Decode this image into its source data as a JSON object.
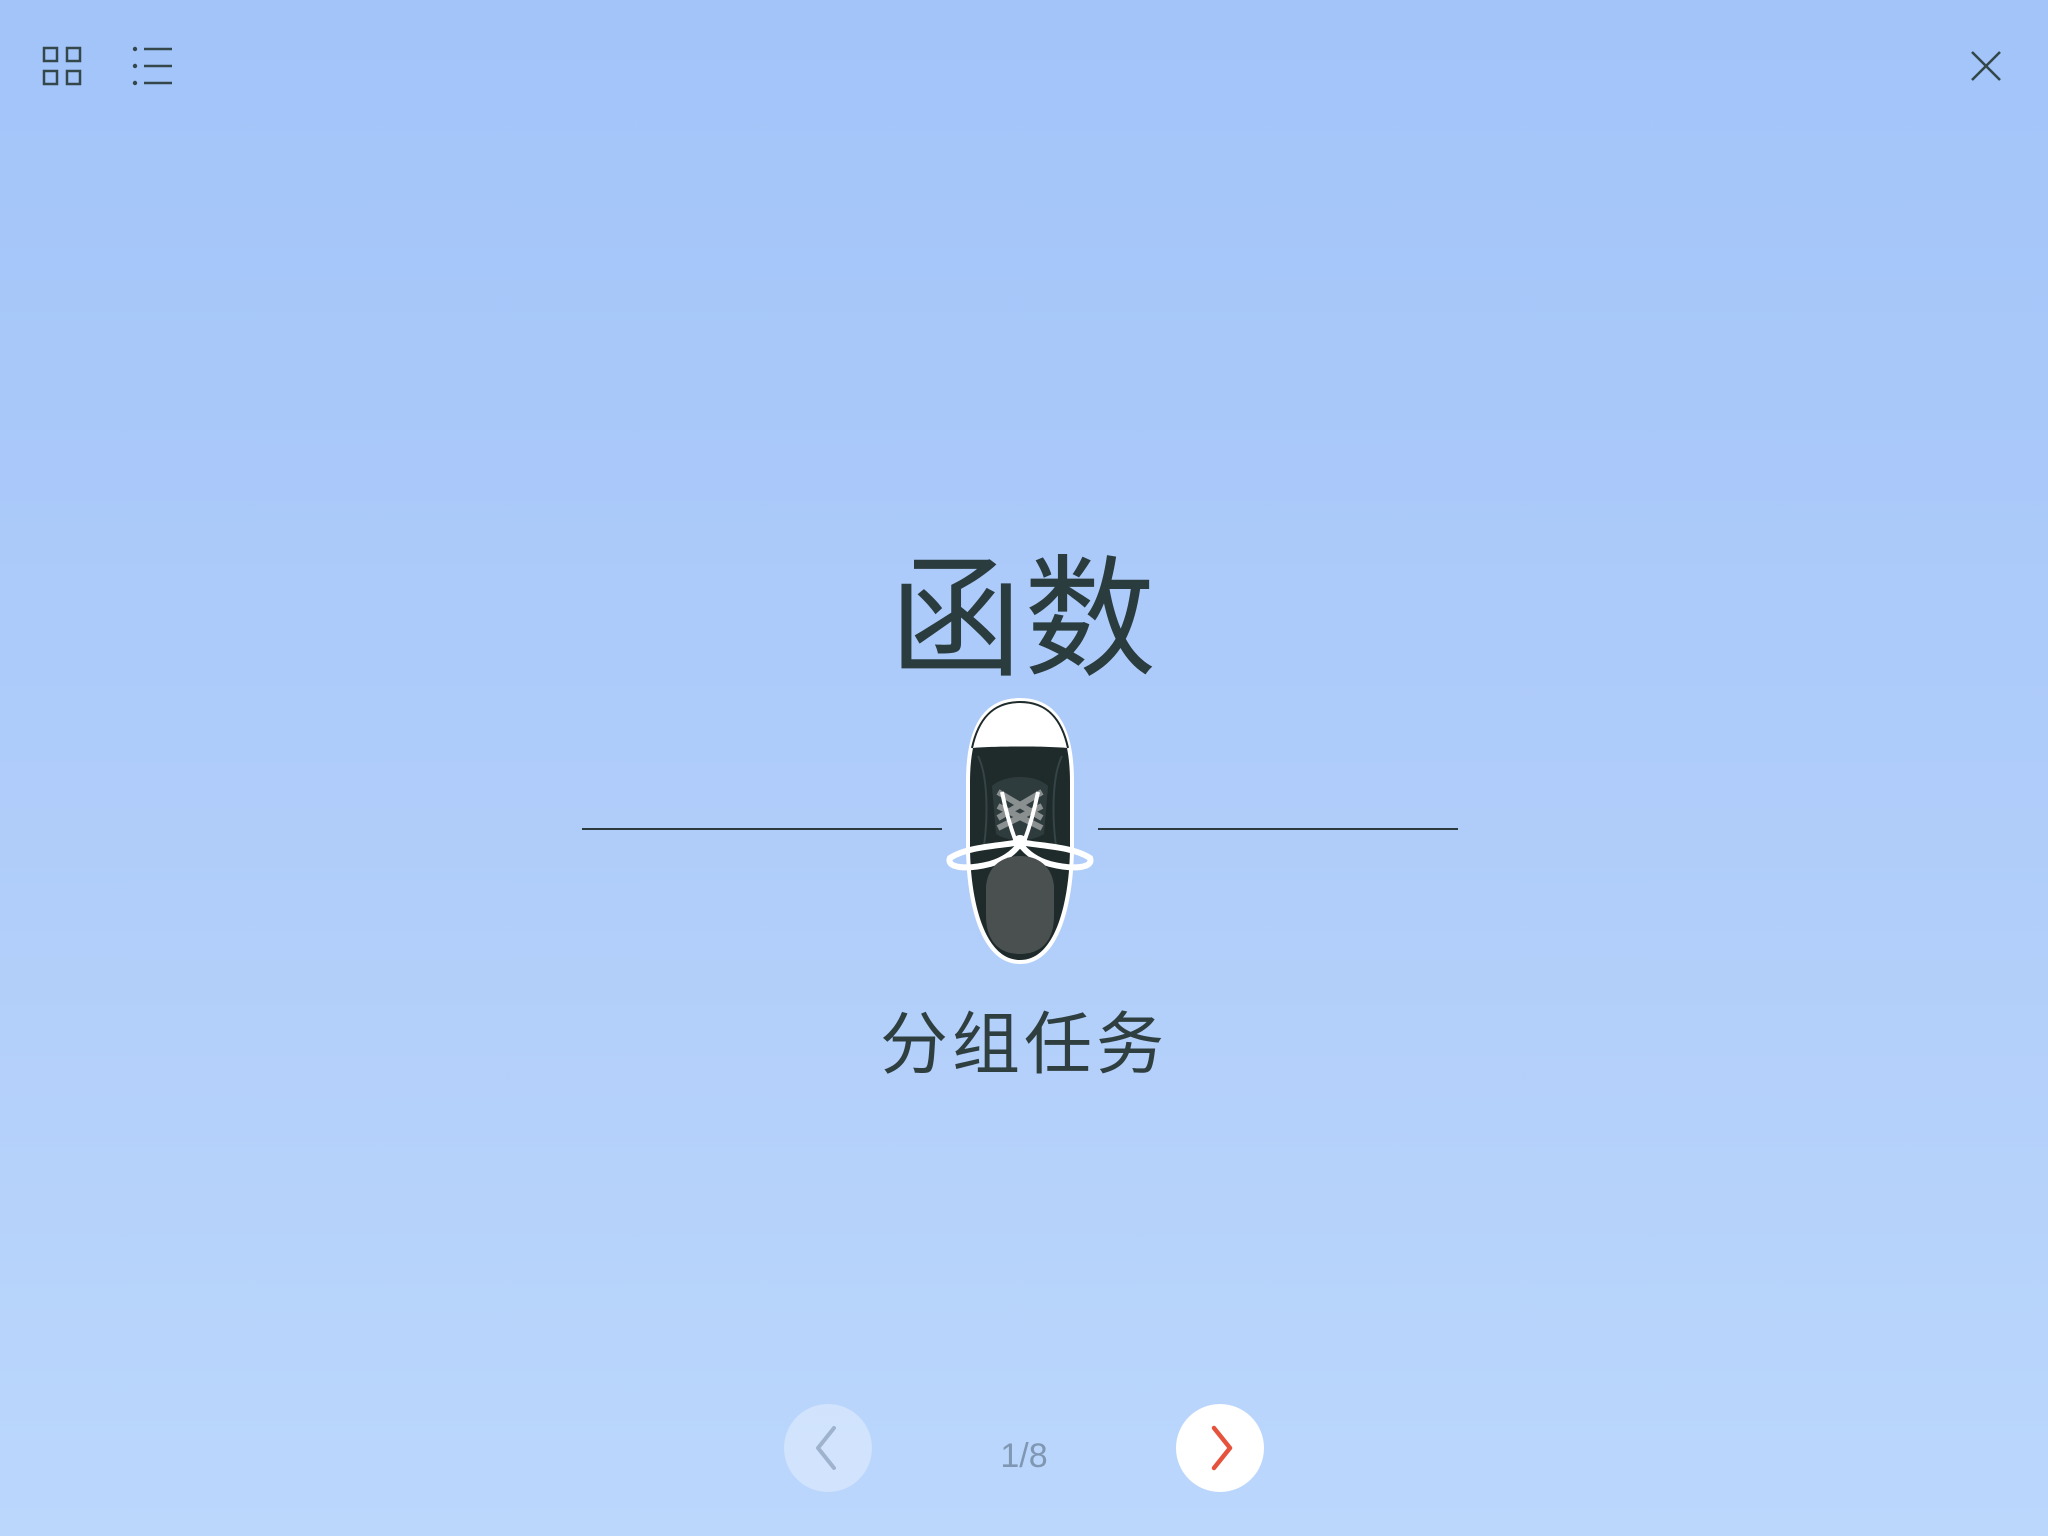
{
  "toolbar": {
    "grid_icon": "grid-icon",
    "list_icon": "list-icon",
    "close_icon": "close-icon"
  },
  "slide": {
    "title": "函数",
    "subtitle": "分组任务",
    "illustration": "sneaker-icon"
  },
  "navigation": {
    "prev_icon": "chevron-left-icon",
    "next_icon": "chevron-right-icon",
    "page_indicator": "1/8",
    "current_page": 1,
    "total_pages": 8
  },
  "colors": {
    "background_top": "#a2c4f9",
    "background_bottom": "#bbd7fc",
    "text": "#2a3c3d",
    "accent_next": "#e5533d",
    "prev_disabled": "#9fb3cf"
  }
}
